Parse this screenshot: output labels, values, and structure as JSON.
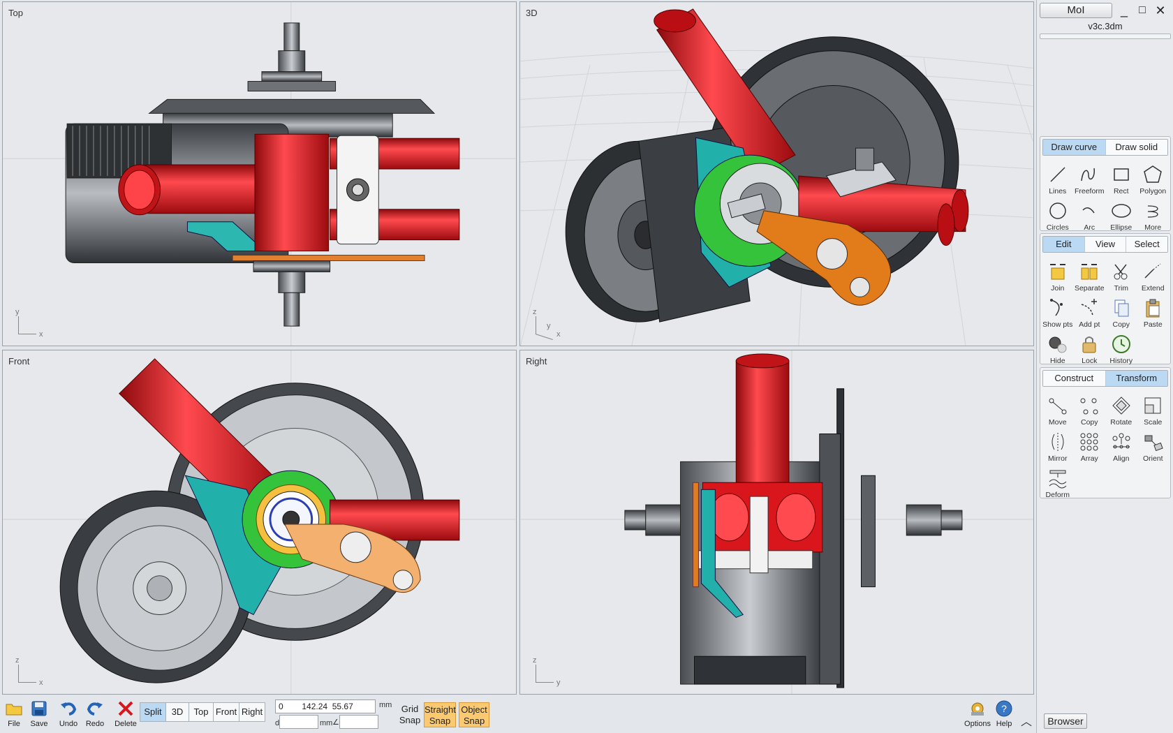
{
  "viewports": {
    "top": {
      "title": "Top",
      "axis_v": "y",
      "axis_h": "x"
    },
    "perspective": {
      "title": "3D",
      "axis_v": "z",
      "axis_h": "x",
      "axis_d": "y"
    },
    "front": {
      "title": "Front",
      "axis_v": "z",
      "axis_h": "x"
    },
    "right": {
      "title": "Right",
      "axis_v": "z",
      "axis_h": "y"
    }
  },
  "app": {
    "name": "MoI",
    "file": "v3c.3dm",
    "minimize": "_",
    "maximize": "□",
    "close": "✕"
  },
  "draw_panel": {
    "tabs": [
      "Draw curve",
      "Draw solid"
    ],
    "active_tab": "Draw curve",
    "tools": [
      {
        "label": "Lines",
        "icon": "line-icon"
      },
      {
        "label": "Freeform",
        "icon": "freeform-icon"
      },
      {
        "label": "Rect",
        "icon": "rect-icon"
      },
      {
        "label": "Polygon",
        "icon": "polygon-icon"
      },
      {
        "label": "Circles",
        "icon": "circle-icon"
      },
      {
        "label": "Arc",
        "icon": "arc-icon"
      },
      {
        "label": "Ellipse",
        "icon": "ellipse-icon"
      },
      {
        "label": "More",
        "icon": "more-icon"
      }
    ]
  },
  "edit_panel": {
    "tabs": [
      "Edit",
      "View",
      "Select"
    ],
    "active_tab": "Edit",
    "tools": [
      {
        "label": "Join",
        "icon": "join-icon"
      },
      {
        "label": "Separate",
        "icon": "separate-icon"
      },
      {
        "label": "Trim",
        "icon": "scissors-icon"
      },
      {
        "label": "Extend",
        "icon": "extend-icon"
      },
      {
        "label": "Show pts",
        "icon": "show-points-icon"
      },
      {
        "label": "Add pt",
        "icon": "add-point-icon"
      },
      {
        "label": "Copy",
        "icon": "copy-icon"
      },
      {
        "label": "Paste",
        "icon": "paste-icon"
      },
      {
        "label": "Hide",
        "icon": "hide-icon"
      },
      {
        "label": "Lock",
        "icon": "lock-icon"
      },
      {
        "label": "History",
        "icon": "history-icon"
      }
    ]
  },
  "transform_panel": {
    "tabs": [
      "Construct",
      "Transform"
    ],
    "active_tab": "Transform",
    "tools": [
      {
        "label": "Move",
        "icon": "move-icon"
      },
      {
        "label": "Copy",
        "icon": "copy-transform-icon"
      },
      {
        "label": "Rotate",
        "icon": "rotate-icon"
      },
      {
        "label": "Scale",
        "icon": "scale-icon"
      },
      {
        "label": "Mirror",
        "icon": "mirror-icon"
      },
      {
        "label": "Array",
        "icon": "array-icon"
      },
      {
        "label": "Align",
        "icon": "align-icon"
      },
      {
        "label": "Orient",
        "icon": "orient-icon"
      },
      {
        "label": "Deform",
        "icon": "deform-icon"
      }
    ]
  },
  "toolbar": {
    "file": "File",
    "save": "Save",
    "undo": "Undo",
    "redo": "Redo",
    "delete": "Delete",
    "view_buttons": [
      "Split",
      "3D",
      "Top",
      "Front",
      "Right"
    ],
    "active_view": "Split",
    "coords": "0        142.24  55.67",
    "unit": "mm",
    "distance_label": "d",
    "distance_unit": "mm",
    "angle_label": "∠",
    "grid_snap": [
      "Grid",
      "Snap"
    ],
    "straight_snap": [
      "Straight",
      "Snap"
    ],
    "object_snap": [
      "Object",
      "Snap"
    ],
    "options": "Options",
    "help": "Help",
    "collapse": "︿",
    "browser": "Browser"
  },
  "colors": {
    "active_tab": "#bcd9f3",
    "snap_on": "#fbc96f",
    "tube_red": "#d8161b",
    "teal": "#1fb3ad",
    "green": "#35c43a",
    "orange": "#e27b1a"
  }
}
